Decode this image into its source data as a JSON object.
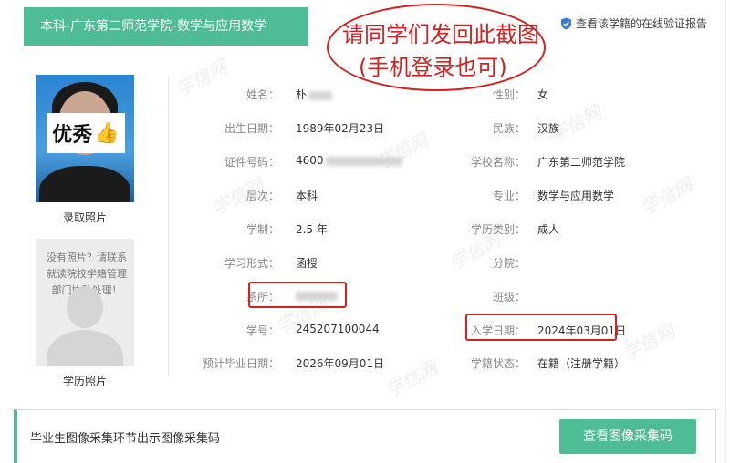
{
  "header": {
    "program": "本科-广东第二师范学院-数学与应用数学",
    "verify_link": "查看该学籍的在线验证报告"
  },
  "notice": {
    "line1": "请同学们发回此截图",
    "line2": "(手机登录也可)"
  },
  "photos": {
    "admission_badge": "优秀",
    "admission_caption": "录取照片",
    "diploma_placeholder": "没有照片？请联系就读院校学籍管理部门协助处理！",
    "diploma_caption": "学历照片"
  },
  "fields": {
    "name": {
      "label": "姓名：",
      "value": "朴"
    },
    "gender": {
      "label": "性别：",
      "value": "女"
    },
    "birthdate": {
      "label": "出生日期：",
      "value": "1989年02月23日"
    },
    "ethnicity": {
      "label": "民族：",
      "value": "汉族"
    },
    "id_number": {
      "label": "证件号码：",
      "value": "4600"
    },
    "school": {
      "label": "学校名称：",
      "value": "广东第二师范学院"
    },
    "level": {
      "label": "层次：",
      "value": "本科"
    },
    "major": {
      "label": "专业：",
      "value": "数学与应用数学"
    },
    "duration": {
      "label": "学制：",
      "value": "2.5 年"
    },
    "category": {
      "label": "学历类别：",
      "value": "成人"
    },
    "study_mode": {
      "label": "学习形式：",
      "value": "函授"
    },
    "branch": {
      "label": "分院：",
      "value": ""
    },
    "department": {
      "label": "系所：",
      "value": ""
    },
    "class": {
      "label": "班级：",
      "value": ""
    },
    "student_id": {
      "label": "学号：",
      "value": "245207100044"
    },
    "enroll_date": {
      "label": "入学日期：",
      "value": "2024年03月01日"
    },
    "grad_date": {
      "label": "预计毕业日期：",
      "value": "2026年09月01日"
    },
    "status": {
      "label": "学籍状态：",
      "value": "在籍（注册学籍）"
    }
  },
  "bottom": {
    "text": "毕业生图像采集环节出示图像采集码",
    "button": "查看图像采集码"
  },
  "watermark": "学信网",
  "colors": {
    "accent": "#4ebd96",
    "annotation": "#d42020"
  }
}
